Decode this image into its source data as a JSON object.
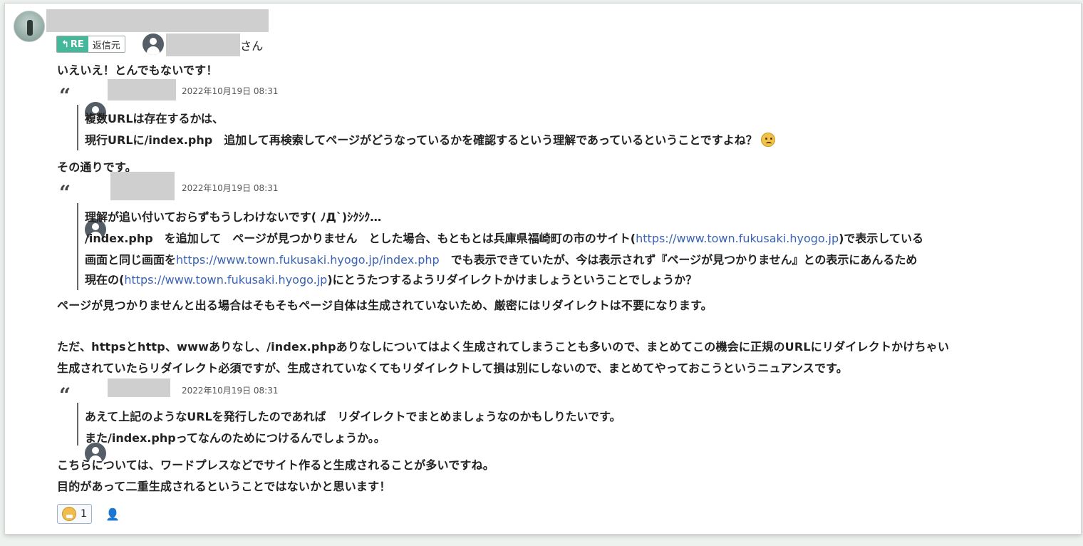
{
  "message": {
    "mention_suffix": "さん",
    "re_badge": {
      "re": "RE",
      "source": "返信元"
    },
    "paragraphs": {
      "p1": "いえいえ！とんでもないです！",
      "p2": "その通りです。",
      "p3": "ページが見つかりませんと出る場合はそもそもページ自体は生成されていないため、厳密にはリダイレクトは不要になります。",
      "p4": "ただ、httpsとhttp、wwwありなし、/index.phpありなしについてはよく生成されてしまうことも多いので、まとめてこの機会に正規のURLにリダイレクトかけちゃい",
      "p5": "生成されていたらリダイレクト必須ですが、生成されていなくてもリダイレクトして損は別にしないので、まとめてやっておこうというニュアンスです。",
      "p6": "こちらについては、ワードプレスなどでサイト作ると生成されることが多いですね。",
      "p7": "目的があって二重生成されるということではないかと思います！"
    }
  },
  "quotes": [
    {
      "timestamp": "2022年10月19日 08:31",
      "line1": "複数URLは存在するかは、",
      "line2": "現行URLに/index.php　追加して再検索してページがどうなっているかを確認するという理解であっているということですよね？"
    },
    {
      "timestamp": "2022年10月19日 08:31",
      "line1": "理解が追い付いておらずもうしわけないです( ﾉД`)ｼｸｼｸ…",
      "line2a": "/index.php　を追加して　ページが見つかりません　とした場合、もともとは兵庫県福崎町の市のサイト(",
      "line2_link": "https://www.town.fukusaki.hyogo.jp",
      "line2b": ")で表示している",
      "line3a": "画面と同じ画面を",
      "line3_link": "https://www.town.fukusaki.hyogo.jp/index.php",
      "line3b": "　でも表示できていたが、今は表示されず『ページが見つかりません』との表示にあんるため",
      "line4a": "現在の(",
      "line4_link": "https://www.town.fukusaki.hyogo.jp",
      "line4b": ")にとうたつするようリダイレクトかけましょうということでしょうか？"
    },
    {
      "timestamp": "2022年10月19日 08:31",
      "line1": "あえて上記のようなURLを発行したのであれば　リダイレクトでまとめましょうなのかもしりたいです。",
      "line2": "また/index.phpってなんのためにつけるんでしょうか。。"
    }
  ],
  "reactions": {
    "count": "1"
  },
  "icons": {
    "reply": "reply-arrow-icon",
    "person": "person-icon",
    "quote": "quote-mark-icon",
    "reaction": "emoji-reaction-icon",
    "add_reaction": "add-reaction-icon"
  },
  "colors": {
    "re_badge": "#45b79b",
    "link": "#3a63b5"
  }
}
